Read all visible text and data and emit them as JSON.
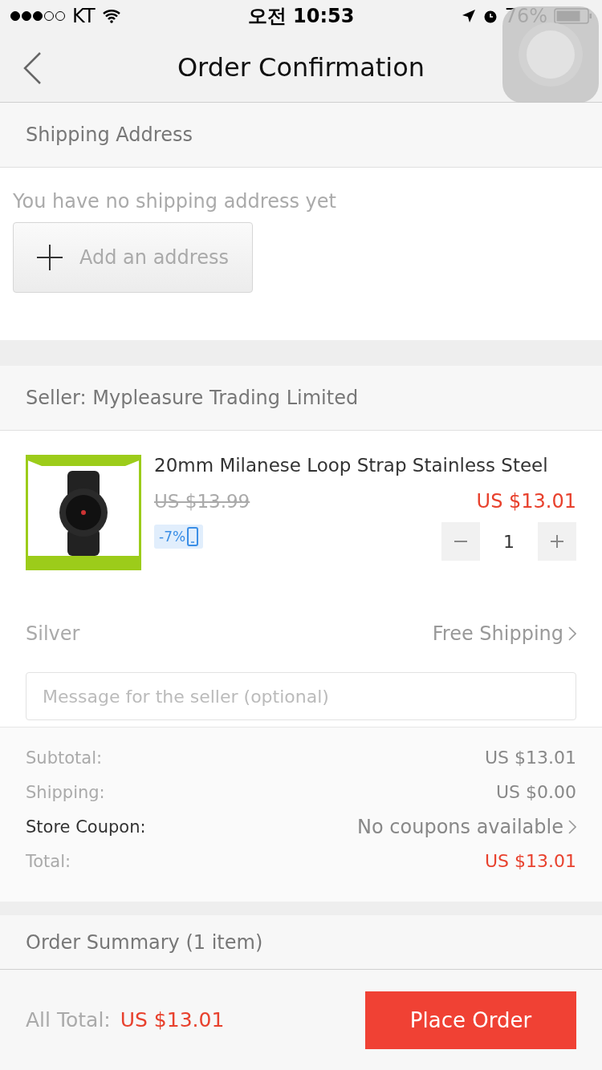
{
  "status_bar": {
    "carrier": "KT",
    "time": "오전 10:53",
    "battery": "76%"
  },
  "nav": {
    "title": "Order Confirmation"
  },
  "shipping": {
    "header": "Shipping Address",
    "empty_text": "You have no shipping address yet",
    "add_button": "Add an address"
  },
  "seller": {
    "header": "Seller: Mypleasure Trading Limited"
  },
  "product": {
    "title": "20mm Milanese Loop Strap Stainless Steel",
    "old_price": "US $13.99",
    "price": "US $13.01",
    "discount": "-7%",
    "quantity": "1",
    "variant": "Silver",
    "shipping": "Free Shipping"
  },
  "message": {
    "placeholder": "Message for the seller (optional)"
  },
  "summary": [
    {
      "label": "Subtotal:",
      "value": "US $13.01",
      "kind": "plain"
    },
    {
      "label": "Shipping:",
      "value": "US $0.00",
      "kind": "plain"
    },
    {
      "label": "Store Coupon:",
      "value": "No coupons available",
      "kind": "link"
    },
    {
      "label": "Total:",
      "value": "US $13.01",
      "kind": "total"
    }
  ],
  "order_summary": {
    "header": "Order Summary (1 item)"
  },
  "footer": {
    "label": "All Total:",
    "total": "US $13.01",
    "button": "Place Order"
  }
}
